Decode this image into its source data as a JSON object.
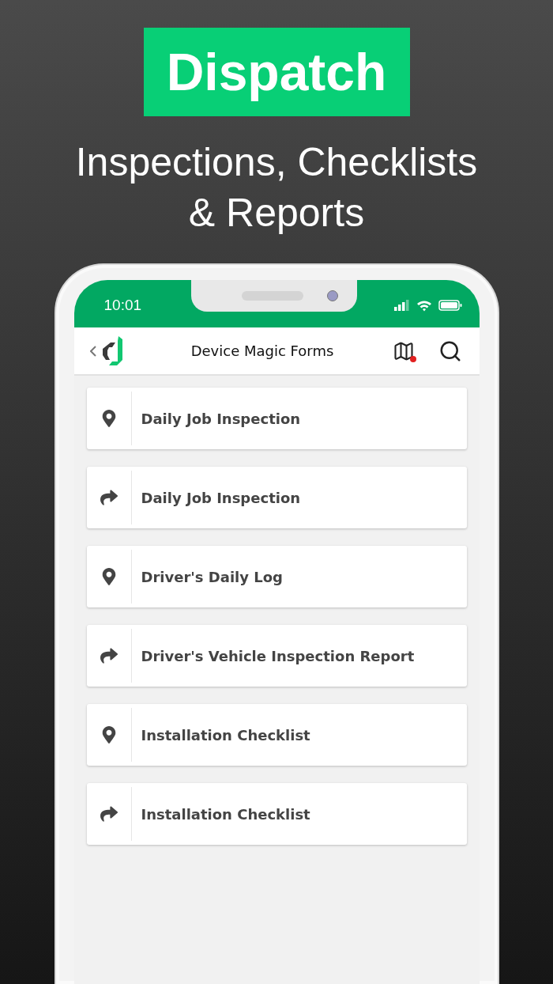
{
  "banner": {
    "title": "Dispatch",
    "subtitle_lines": [
      "Inspections, Checklists",
      "& Reports"
    ]
  },
  "status_bar": {
    "time": "10:01"
  },
  "header": {
    "title": "Device Magic Forms"
  },
  "forms": [
    {
      "kind": "location",
      "label": "Daily Job Inspection"
    },
    {
      "kind": "forward",
      "label": "Daily Job Inspection"
    },
    {
      "kind": "location",
      "label": "Driver's Daily Log"
    },
    {
      "kind": "forward",
      "label": "Driver's Vehicle Inspection Report"
    },
    {
      "kind": "location",
      "label": "Installation Checklist"
    },
    {
      "kind": "forward",
      "label": "Installation Checklist"
    }
  ]
}
